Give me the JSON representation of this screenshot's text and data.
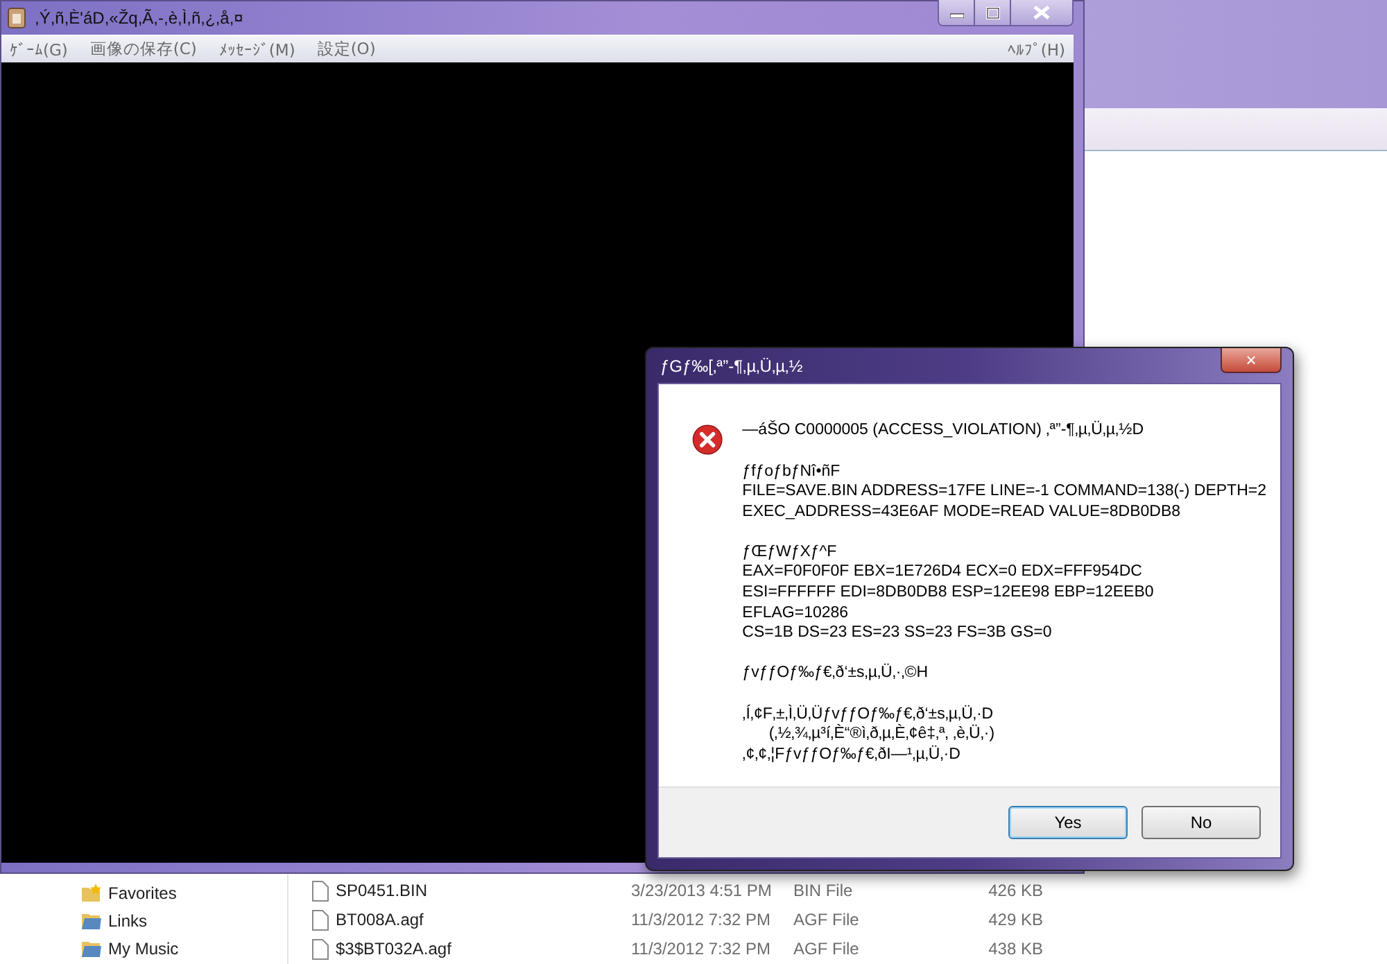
{
  "explorer": {
    "sidebar": {
      "items": [
        {
          "label": "Favorites",
          "kind": "favorites"
        },
        {
          "label": "Links",
          "kind": "folder"
        },
        {
          "label": "My Music",
          "kind": "folder"
        }
      ]
    },
    "files": [
      {
        "name": "SP0451.BIN",
        "date": "3/23/2013 4:51 PM",
        "type": "BIN File",
        "size": "426 KB"
      },
      {
        "name": "BT008A.agf",
        "date": "11/3/2012 7:32 PM",
        "type": "AGF File",
        "size": "429 KB"
      },
      {
        "name": "$3$BT032A.agf",
        "date": "11/3/2012 7:32 PM",
        "type": "AGF File",
        "size": "438 KB"
      }
    ]
  },
  "game_window": {
    "title": ",Ý,ñ,È'áD,«Žq,Ã,-,è,Ì,ñ,¿,å,¤",
    "menu": [
      "ｹﾞｰﾑ(G)",
      "画像の保存(C)",
      "ﾒｯｾｰｼﾞ(M)",
      "設定(O)"
    ],
    "help_menu": "ﾍﾙﾌﾟ(H)"
  },
  "dialog": {
    "title": "ƒGƒ‰[‚ª”-¶‚µ‚Ü‚µ‚½",
    "close": "×",
    "paragraphs": [
      [
        "—áŠO C0000005 (ACCESS_VIOLATION) ‚ª”-¶‚µ‚Ü‚µ‚½D"
      ],
      [
        "ƒfƒoƒbƒNî•ñF",
        "FILE=SAVE.BIN ADDRESS=17FE LINE=-1 COMMAND=138(-) DEPTH=2",
        "EXEC_ADDRESS=43E6AF MODE=READ VALUE=8DB0DB8"
      ],
      [
        "ƒŒƒWƒXƒ^F",
        "EAX=F0F0F0F EBX=1E726D4 ECX=0 EDX=FFF954DC",
        "ESI=FFFFFF EDI=8DB0DB8 ESP=12EE98 EBP=12EEB0",
        "EFLAG=10286",
        "CS=1B DS=23 ES=23 SS=23 FS=3B GS=0"
      ],
      [
        "ƒvƒƒOƒ‰ƒ€‚ð‘±s‚µ‚Ü‚·‚©H"
      ],
      [
        "‚Í‚¢F‚±‚Ì‚Ü‚ÜƒvƒƒOƒ‰ƒ€‚ð‘±s‚µ‚Ü‚·D",
        "      (‚½‚¾‚µ³í‚È“®ì‚ð‚µ‚È‚¢ê‡‚ª‚ ‚è‚Ü‚·)",
        "‚¢‚¢‚¦FƒvƒƒOƒ‰ƒ€‚ðI—¹‚µ‚Ü‚·D"
      ]
    ],
    "buttons": [
      {
        "label": "Yes",
        "selected": true
      },
      {
        "label": "No",
        "selected": false
      }
    ]
  }
}
